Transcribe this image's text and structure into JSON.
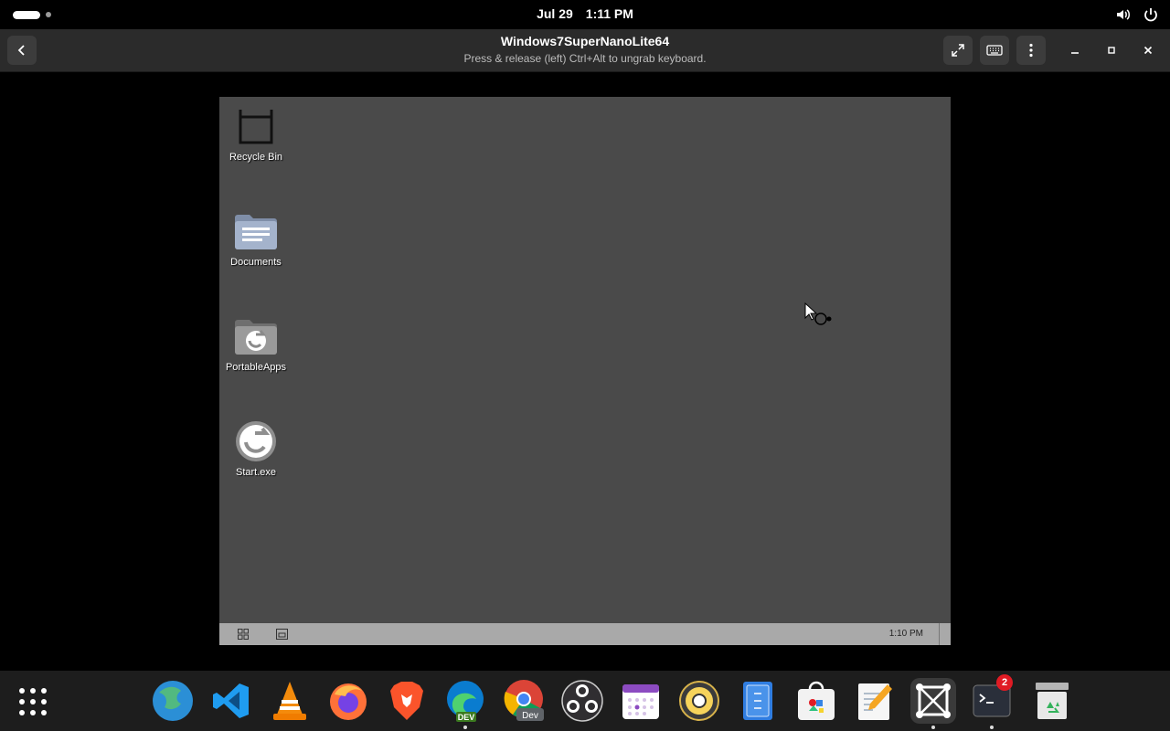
{
  "topbar": {
    "date": "Jul 29",
    "time": "1:11 PM"
  },
  "header": {
    "title": "Windows7SuperNanoLite64",
    "subtitle": "Press & release (left) Ctrl+Alt to ungrab keyboard."
  },
  "vm": {
    "desktop_icons": [
      {
        "label": "Recycle Bin",
        "icon": "recycle-bin-icon"
      },
      {
        "label": "Documents",
        "icon": "folder-documents-icon"
      },
      {
        "label": "PortableApps",
        "icon": "folder-portableapps-icon"
      },
      {
        "label": "Start.exe",
        "icon": "start-exe-icon"
      }
    ],
    "taskbar": {
      "clock": "1:10 PM"
    }
  },
  "dock": {
    "apps": [
      {
        "name": "globe-browser-icon"
      },
      {
        "name": "vscode-icon"
      },
      {
        "name": "vlc-icon"
      },
      {
        "name": "firefox-icon"
      },
      {
        "name": "brave-icon"
      },
      {
        "name": "edge-dev-icon",
        "badge_text": "DEV"
      },
      {
        "name": "chrome-dev-icon",
        "badge_text": "Dev"
      },
      {
        "name": "obs-icon"
      },
      {
        "name": "calendar-icon"
      },
      {
        "name": "speaker-app-icon"
      },
      {
        "name": "file-archive-icon"
      },
      {
        "name": "software-store-icon"
      },
      {
        "name": "text-editor-icon"
      },
      {
        "name": "boxes-vm-icon"
      },
      {
        "name": "terminal-icon",
        "badge": "2"
      },
      {
        "name": "trash-icon"
      }
    ]
  },
  "colors": {
    "vm_desktop": "#4a4a4a",
    "dock": "#1d1d1d",
    "header": "#2b2b2b",
    "badge": "#e01b24"
  }
}
